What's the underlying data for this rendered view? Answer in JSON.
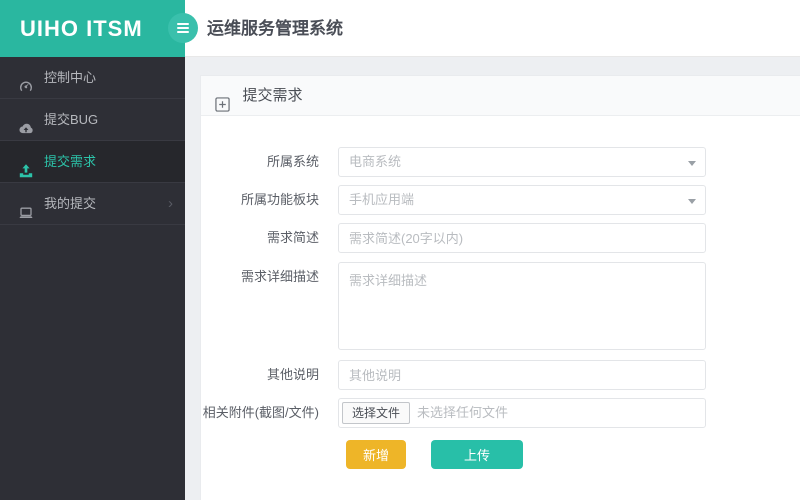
{
  "header": {
    "logo": "UIHO ITSM",
    "title": "运维服务管理系统"
  },
  "sidebar": {
    "items": [
      {
        "label": "控制中心",
        "icon": "dashboard-icon",
        "active": false
      },
      {
        "label": "提交BUG",
        "icon": "cloud-upload-icon",
        "active": false
      },
      {
        "label": "提交需求",
        "icon": "upload-icon",
        "active": true
      },
      {
        "label": "我的提交",
        "icon": "laptop-icon",
        "active": false,
        "chevron": "›"
      }
    ]
  },
  "panel": {
    "icon": "plus-square-icon",
    "title": "提交需求"
  },
  "form": {
    "fields": [
      {
        "label": "所属系统",
        "type": "select",
        "value": "电商系统"
      },
      {
        "label": "所属功能板块",
        "type": "select",
        "value": "手机应用端"
      },
      {
        "label": "需求简述",
        "type": "input",
        "placeholder": "需求简述(20字以内)"
      },
      {
        "label": "需求详细描述",
        "type": "textarea",
        "placeholder": "需求详细描述"
      },
      {
        "label": "其他说明",
        "type": "input",
        "placeholder": "其他说明"
      },
      {
        "label": "相关附件(截图/文件)",
        "type": "file",
        "button": "选择文件",
        "status": "未选择任何文件"
      }
    ],
    "buttons": [
      {
        "label": "新增",
        "color": "#eeb528"
      },
      {
        "label": "上传",
        "color": "#28bfa8"
      }
    ]
  },
  "colors": {
    "teal": "#2ab7a0",
    "sidebar_bg": "#2e2f36",
    "active_text": "#2cc3a9",
    "yellow_button": "#eeb528",
    "teal_button": "#28bfa8",
    "content_bg": "#edeff2"
  }
}
